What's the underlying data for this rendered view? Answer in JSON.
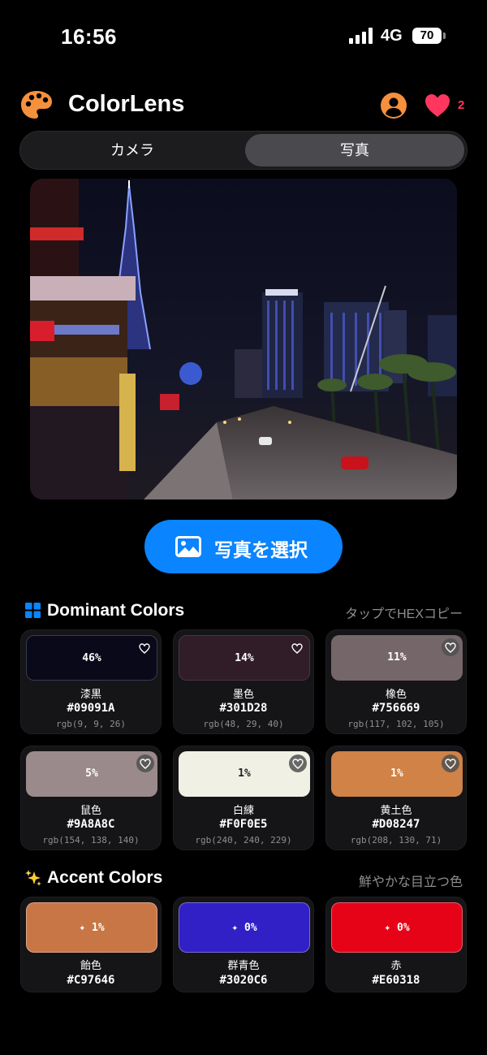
{
  "status": {
    "time": "16:56",
    "network": "4G",
    "battery": "70"
  },
  "header": {
    "title": "ColorLens",
    "favorites_count": "2"
  },
  "tabs": [
    {
      "label": "カメラ",
      "active": false
    },
    {
      "label": "写真",
      "active": true
    }
  ],
  "select_button": {
    "label": "写真を選択"
  },
  "dominant": {
    "title": "Dominant Colors",
    "hint": "タップでHEXコピー",
    "colors": [
      {
        "percent": "46%",
        "name": "漆黒",
        "hex": "#09091A",
        "rgb": "rgb(9, 9, 26)",
        "swatch": "#09091a",
        "text": "#ffffff"
      },
      {
        "percent": "14%",
        "name": "墨色",
        "hex": "#301D28",
        "rgb": "rgb(48, 29, 40)",
        "swatch": "#301d28",
        "text": "#ffffff"
      },
      {
        "percent": "11%",
        "name": "橡色",
        "hex": "#756669",
        "rgb": "rgb(117, 102, 105)",
        "swatch": "#756669",
        "text": "#ffffff"
      },
      {
        "percent": "5%",
        "name": "鼠色",
        "hex": "#9A8A8C",
        "rgb": "rgb(154, 138, 140)",
        "swatch": "#9a8a8c",
        "text": "#ffffff"
      },
      {
        "percent": "1%",
        "name": "白練",
        "hex": "#F0F0E5",
        "rgb": "rgb(240, 240, 229)",
        "swatch": "#f0f0e5",
        "text": "#222222"
      },
      {
        "percent": "1%",
        "name": "黄土色",
        "hex": "#D08247",
        "rgb": "rgb(208, 130, 71)",
        "swatch": "#d08247",
        "text": "#ffffff"
      }
    ]
  },
  "accent": {
    "title": "Accent Colors",
    "hint": "鮮やかな目立つ色",
    "colors": [
      {
        "percent": "✦ 1%",
        "name": "飴色",
        "hex": "#C97646",
        "swatch": "#c97646"
      },
      {
        "percent": "✦ 0%",
        "name": "群青色",
        "hex": "#3020C6",
        "swatch": "#3020c6"
      },
      {
        "percent": "✦ 0%",
        "name": "赤",
        "hex": "#E60318",
        "swatch": "#e60318"
      }
    ]
  },
  "colors": {
    "accent_blue": "#0a84ff",
    "heart": "#ff375f",
    "palette": "#f5903d"
  },
  "icons": [
    "signal-icon",
    "battery-icon",
    "palette-icon",
    "profile-icon",
    "heart-icon",
    "photo-icon",
    "grid-icon",
    "sparkles-icon",
    "heart-outline-icon"
  ]
}
